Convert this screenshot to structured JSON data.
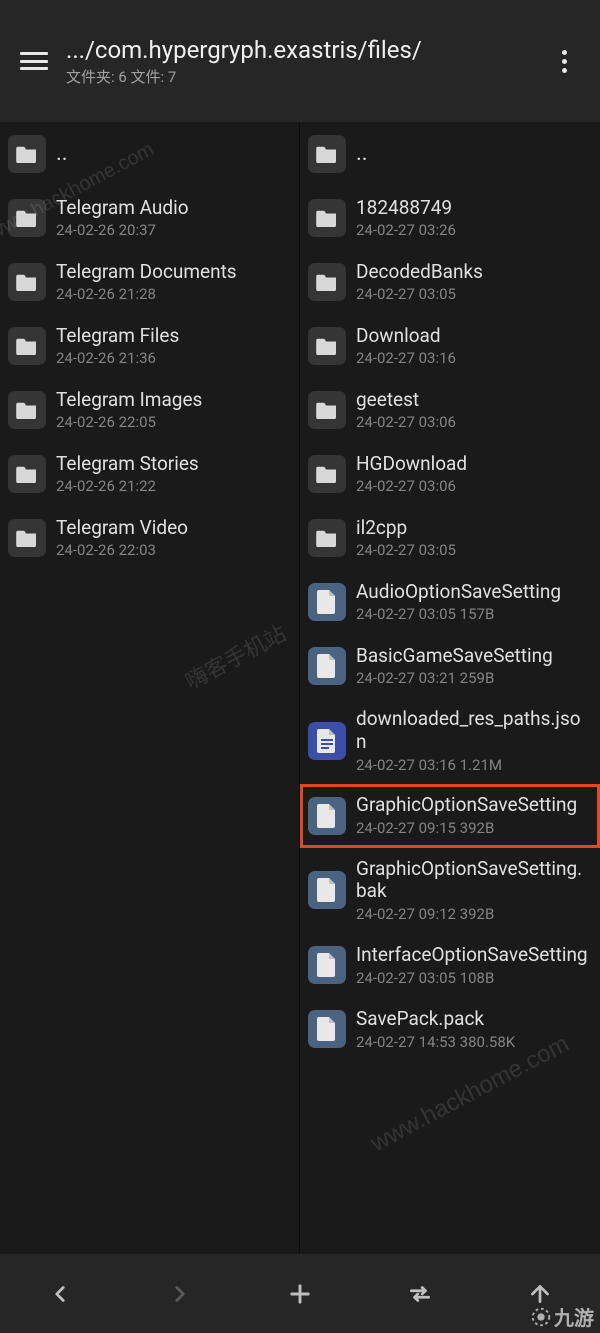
{
  "header": {
    "path": ".../com.hypergryph.exastris/files/",
    "subtitle": "文件夹: 6  文件: 7"
  },
  "left": [
    {
      "type": "up",
      "name": ".."
    },
    {
      "type": "folder",
      "name": "Telegram Audio",
      "sub": "24-02-26 20:37"
    },
    {
      "type": "folder",
      "name": "Telegram Documents",
      "sub": "24-02-26 21:28"
    },
    {
      "type": "folder",
      "name": "Telegram Files",
      "sub": "24-02-26 21:36"
    },
    {
      "type": "folder",
      "name": "Telegram Images",
      "sub": "24-02-26 22:05"
    },
    {
      "type": "folder",
      "name": "Telegram Stories",
      "sub": "24-02-26 21:22"
    },
    {
      "type": "folder",
      "name": "Telegram Video",
      "sub": "24-02-26 22:03"
    }
  ],
  "right": [
    {
      "type": "up",
      "name": ".."
    },
    {
      "type": "folder",
      "name": "182488749",
      "sub": "24-02-27 03:26"
    },
    {
      "type": "folder",
      "name": "DecodedBanks",
      "sub": "24-02-27 03:05"
    },
    {
      "type": "folder",
      "name": "Download",
      "sub": "24-02-27 03:16"
    },
    {
      "type": "folder",
      "name": "geetest",
      "sub": "24-02-27 03:06"
    },
    {
      "type": "folder",
      "name": "HGDownload",
      "sub": "24-02-27 03:06"
    },
    {
      "type": "folder",
      "name": "il2cpp",
      "sub": "24-02-27 03:05"
    },
    {
      "type": "file",
      "name": "AudioOptionSaveSetting",
      "sub": "24-02-27 03:05  157B"
    },
    {
      "type": "file",
      "name": "BasicGameSaveSetting",
      "sub": "24-02-27 03:21  259B"
    },
    {
      "type": "filejson",
      "name": "downloaded_res_paths.json",
      "sub": "24-02-27 03:16  1.21M"
    },
    {
      "type": "file",
      "name": "GraphicOptionSaveSetting",
      "sub": "24-02-27 09:15  392B",
      "highlighted": true
    },
    {
      "type": "file",
      "name": "GraphicOptionSaveSetting.bak",
      "sub": "24-02-27 09:12  392B"
    },
    {
      "type": "file",
      "name": "InterfaceOptionSaveSetting",
      "sub": "24-02-27 03:05  108B"
    },
    {
      "type": "file",
      "name": "SavePack.pack",
      "sub": "24-02-27 14:53  380.58K"
    }
  ],
  "watermarks": {
    "w1": "www.hackhome.com",
    "w2": "嗨客手机站",
    "w3": "www.hackhome.com",
    "corner": "九游"
  }
}
